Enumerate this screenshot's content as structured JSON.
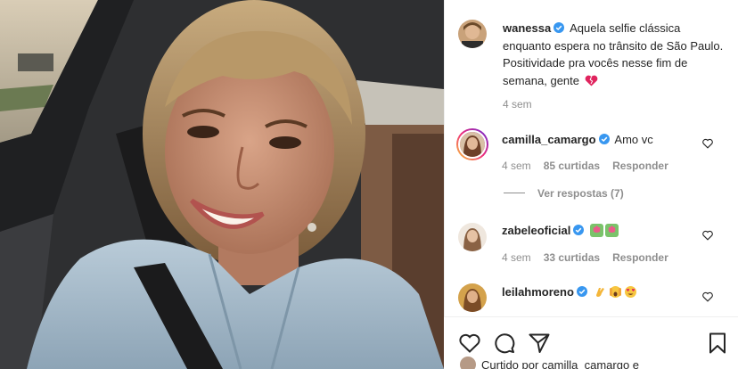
{
  "post": {
    "author": "wanessa",
    "caption": "Aquela selfie clássica enquanto espera no trânsito de São Paulo. Positividade pra vocês nesse fim de semana, gente",
    "caption_icon": "broken-heart-emoji",
    "timestamp": "4 sem"
  },
  "comments": [
    {
      "username": "camilla_camargo",
      "text": "Amo vc",
      "time": "4 sem",
      "likes": "85 curtidas",
      "reply": "Responder",
      "view_replies": "Ver respostas (7)"
    },
    {
      "username": "zabeleoficial",
      "emojis": [
        "tulip-emoji",
        "tulip-emoji"
      ],
      "time": "4 sem",
      "likes": "33 curtidas",
      "reply": "Responder"
    },
    {
      "username": "leilahmoreno",
      "emojis": [
        "clapping-hands-emoji",
        "face-with-hands-emoji",
        "heart-eyes-emoji"
      ]
    }
  ],
  "footer": {
    "liked_by": "Curtido por camilla_camargo e"
  },
  "colors": {
    "verified": "#3897f0",
    "meta_gray": "#8e8e8e",
    "text": "#262626",
    "heart_red": "#e0245e"
  }
}
